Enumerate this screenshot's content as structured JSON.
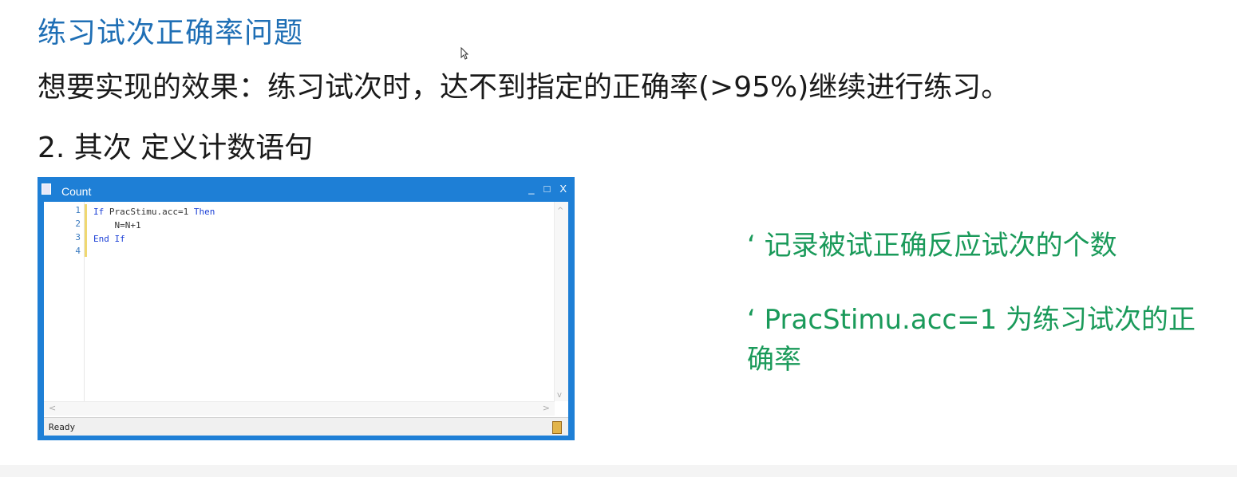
{
  "slide": {
    "title": "练习试次正确率问题",
    "subtitle": "想要实现的效果：练习试次时，达不到指定的正确率(>95%)继续进行练习。",
    "step": "2. 其次 定义计数语句"
  },
  "window": {
    "title": "Count",
    "controls": {
      "minimize": "_",
      "maximize": "□",
      "close": "X"
    },
    "line_numbers": [
      "1",
      "2",
      "3",
      "4"
    ],
    "code": {
      "line1": {
        "kw1": "If",
        "mid": " PracStimu.acc=1 ",
        "kw2": "Then"
      },
      "line2": "    N=N+1",
      "line3": {
        "kw1": "End",
        "sp": " ",
        "kw2": "If"
      },
      "line4": ""
    },
    "status": "Ready",
    "scroll_up": "^",
    "scroll_down": "v",
    "scroll_left": "<",
    "scroll_right": ">"
  },
  "notes": {
    "note1": "‘ 记录被试正确反应试次的个数",
    "note2": "‘ PracStimu.acc=1 为练习试次的正确率"
  },
  "colors": {
    "title_blue": "#1f6fb5",
    "window_blue": "#1e7fd6",
    "note_green": "#1a9a5a",
    "keyword_blue": "#1a3fd6"
  }
}
